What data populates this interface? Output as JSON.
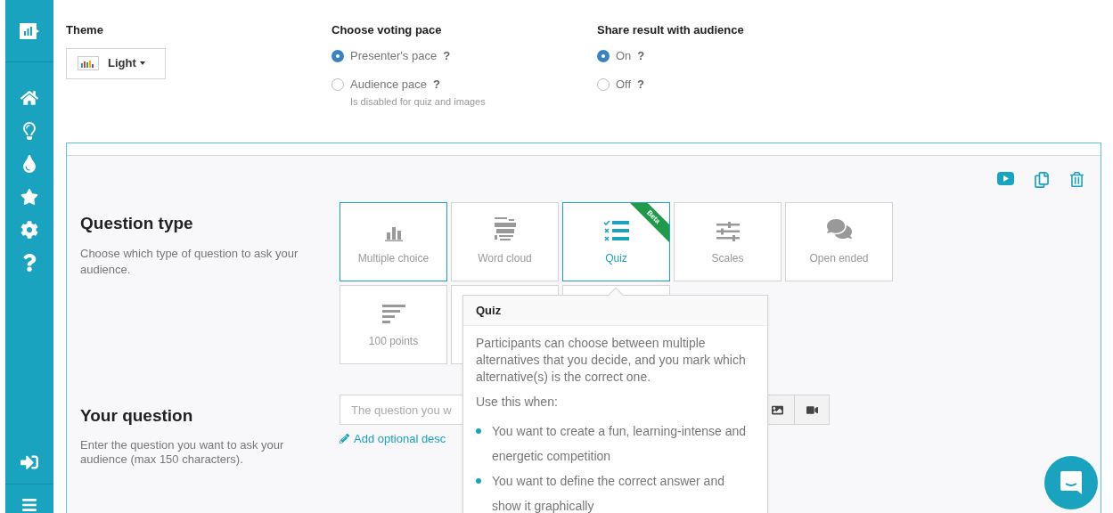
{
  "theme": {
    "label": "Theme",
    "value": "Light"
  },
  "voting_pace": {
    "label": "Choose voting pace",
    "options": [
      {
        "label": "Presenter's pace",
        "help": "?",
        "selected": true
      },
      {
        "label": "Audience pace",
        "help": "?",
        "selected": false,
        "note": "Is disabled for quiz and images"
      }
    ]
  },
  "share_result": {
    "label": "Share result with audience",
    "options": [
      {
        "label": "On",
        "help": "?",
        "selected": true
      },
      {
        "label": "Off",
        "help": "?",
        "selected": false
      }
    ]
  },
  "question_type": {
    "title": "Question type",
    "description": "Choose which type of question to ask your audience.",
    "types": [
      {
        "label": "Multiple choice",
        "outlined": true,
        "selected": false
      },
      {
        "label": "Word cloud",
        "outlined": false,
        "selected": false
      },
      {
        "label": "Quiz",
        "outlined": true,
        "selected": true,
        "badge": "Beta"
      },
      {
        "label": "Scales",
        "outlined": false,
        "selected": false
      },
      {
        "label": "Open ended",
        "outlined": false,
        "selected": false
      },
      {
        "label": "100 points",
        "outlined": false,
        "selected": false
      },
      {
        "outlined": false
      },
      {
        "outlined": false
      }
    ]
  },
  "tooltip": {
    "title": "Quiz",
    "text": "Participants can choose between multiple alternatives that you decide, and you mark which alternative(s) is the correct one.",
    "use_when": "Use this when:",
    "bullets": [
      "You want to create a fun, learning-intense and energetic competition",
      "You want to define the correct answer and show it graphically"
    ]
  },
  "your_question": {
    "title": "Your question",
    "description": "Enter the question you want to ask your audience (max 150 characters).",
    "placeholder": "The question you w",
    "link": "Add optional desc"
  }
}
